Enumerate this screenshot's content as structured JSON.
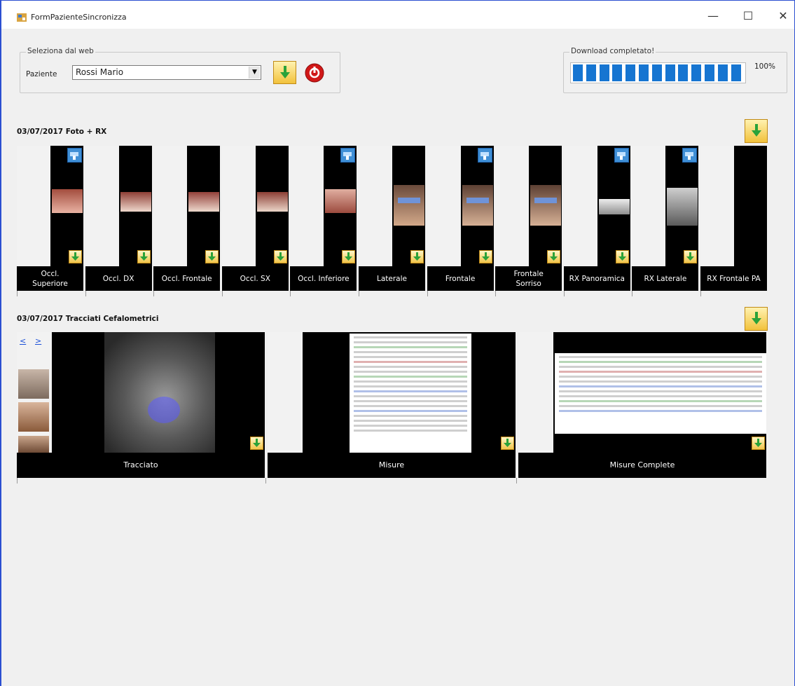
{
  "window": {
    "title": "FormPazienteSincronizza",
    "minimize": "—",
    "maximize": "☐",
    "close": "✕"
  },
  "web_group": {
    "title": "Seleziona dal web",
    "paziente_label": "Paziente",
    "paziente_value": "Rossi Mario"
  },
  "download_group": {
    "title": "Download completato!",
    "percent_text": "100%",
    "progress": 1.0
  },
  "section1": {
    "title": "03/07/2017 Foto + RX",
    "items": [
      {
        "label": "Occl.\nSuperiore"
      },
      {
        "label": "Occl. DX"
      },
      {
        "label": "Occl. Frontale"
      },
      {
        "label": "Occl. SX"
      },
      {
        "label": "Occl. Inferiore"
      },
      {
        "label": "Laterale"
      },
      {
        "label": "Frontale"
      },
      {
        "label": "Frontale\nSorriso"
      },
      {
        "label": "RX Panoramica"
      },
      {
        "label": "RX Laterale"
      },
      {
        "label": "RX Frontale PA"
      }
    ]
  },
  "section2": {
    "title": "03/07/2017 Tracciati Cefalometrici",
    "nav_prev": "<",
    "nav_next": ">",
    "items": [
      {
        "label": "Tracciato"
      },
      {
        "label": "Misure"
      },
      {
        "label": "Misure Complete"
      }
    ]
  },
  "colors": {
    "accent": "#1675d1",
    "window_border": "#2b4fd1",
    "download_button": "#f2c23c"
  }
}
